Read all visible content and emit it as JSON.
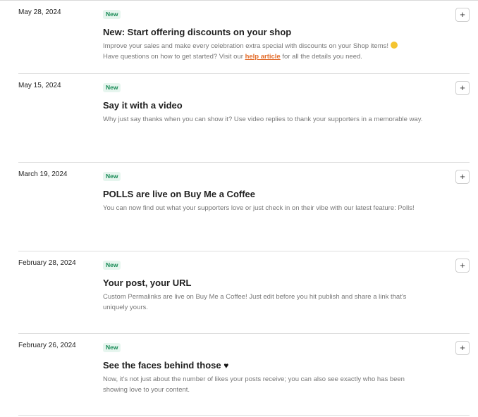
{
  "updates": [
    {
      "date": "May 28, 2024",
      "badge": "New",
      "title": "New: Start offering discounts on your shop",
      "description_line1": "Improve your sales and make every celebration extra special with discounts on your Shop items!",
      "description_emoji": "thinking-face-emoji",
      "description_line2_before": "Have questions on how to get started? Visit our",
      "description_link": "help article",
      "description_line2_after": "for all the details you need.",
      "expand_icon": "+"
    },
    {
      "date": "May 15, 2024",
      "badge": "New",
      "title": "Say it with a video",
      "description": "Why just say thanks when you can show it? Use video replies to thank your supporters in a memorable way.",
      "expand_icon": "+"
    },
    {
      "date": "March 19, 2024",
      "badge": "New",
      "title": "POLLS are live on Buy Me a Coffee",
      "description": "You can now find out what your supporters love or just check in on their vibe with our latest feature: Polls!",
      "expand_icon": "+"
    },
    {
      "date": "February 28, 2024",
      "badge": "New",
      "title": "Your post, your URL",
      "description": "Custom Permalinks are live on Buy Me a Coffee! Just edit before you hit publish and share a link that's uniquely yours.",
      "expand_icon": "+"
    },
    {
      "date": "February 26, 2024",
      "badge": "New",
      "title": "See the faces behind those",
      "title_heart": "♥",
      "description": "Now, it's not just about the number of likes your posts receive; you can also see exactly who has been showing love to your content.",
      "expand_icon": "+"
    }
  ],
  "colors": {
    "badge_bg": "#e6f5ee",
    "badge_text": "#178a55",
    "link": "#e36d2c",
    "description": "#777777"
  }
}
